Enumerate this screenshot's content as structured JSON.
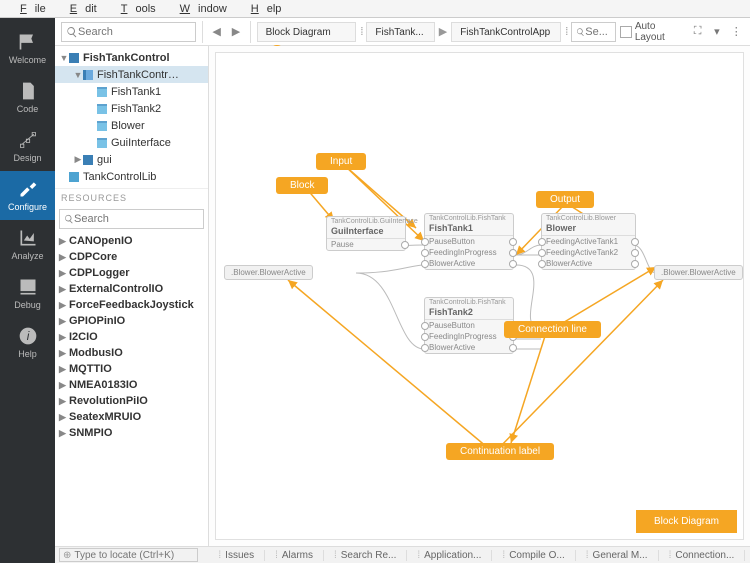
{
  "menu": {
    "file": "File",
    "edit": "Edit",
    "tools": "Tools",
    "window": "Window",
    "help": "Help"
  },
  "sidebar": {
    "items": [
      {
        "label": "Welcome"
      },
      {
        "label": "Code"
      },
      {
        "label": "Design"
      },
      {
        "label": "Configure"
      },
      {
        "label": "Analyze"
      },
      {
        "label": "Debug"
      },
      {
        "label": "Help"
      }
    ]
  },
  "toolbar": {
    "search_ph": "Search",
    "crumb_block": "Block Diagram",
    "crumb_app1": "FishTank...",
    "crumb_app2": "FishTankControlApp",
    "search2_ph": "Se...",
    "auto_layout": "Auto Layout"
  },
  "tree": [
    {
      "depth": 0,
      "tw": "▼",
      "icon": "ic-folder",
      "label": "FishTankControl",
      "bold": true
    },
    {
      "depth": 1,
      "tw": "▼",
      "icon": "ic-cmp",
      "label": "FishTankContr…",
      "selected": true
    },
    {
      "depth": 2,
      "tw": "",
      "icon": "ic-leaf",
      "label": "FishTank1"
    },
    {
      "depth": 2,
      "tw": "",
      "icon": "ic-leaf",
      "label": "FishTank2"
    },
    {
      "depth": 2,
      "tw": "",
      "icon": "ic-leaf",
      "label": "Blower"
    },
    {
      "depth": 2,
      "tw": "",
      "icon": "ic-leaf",
      "label": "GuiInterface"
    },
    {
      "depth": 1,
      "tw": "▶",
      "icon": "ic-folder",
      "label": "gui"
    },
    {
      "depth": 0,
      "tw": "",
      "icon": "ic-lib",
      "label": "TankControlLib"
    }
  ],
  "resources_header": "RESOURCES",
  "resources_search_ph": "Search",
  "resources": [
    "CANOpenIO",
    "CDPCore",
    "CDPLogger",
    "ExternalControlIO",
    "ForceFeedbackJoystick",
    "GPIOPinIO",
    "I2CIO",
    "ModbusIO",
    "MQTTIO",
    "NMEA0183IO",
    "RevolutionPiIO",
    "SeatexMRUIO",
    "SNMPIO"
  ],
  "diagram": {
    "blocks": {
      "gui": {
        "type": "TankControlLib.GuiInterface",
        "name": "GuiInterface",
        "rows": [
          "Pause"
        ]
      },
      "ft1": {
        "type": "TankControlLib.FishTank",
        "name": "FishTank1",
        "rows": [
          "PauseButton",
          "FeedingInProgress",
          "BlowerActive"
        ]
      },
      "ft2": {
        "type": "TankControlLib.FishTank",
        "name": "FishTank2",
        "rows": [
          "PauseButton",
          "FeedingInProgress",
          "BlowerActive"
        ]
      },
      "blower": {
        "type": "TankControlLib.Blower",
        "name": "Blower",
        "rows": [
          "FeedingActiveTank1",
          "FeedingActiveTank2",
          "BlowerActive"
        ]
      }
    },
    "cont_left": ".Blower.BlowerActive",
    "cont_right": ".Blower.BlowerActive",
    "callouts": {
      "input": "Input",
      "block": "Block",
      "output": "Output",
      "conn": "Connection line",
      "cont": "Continuation label"
    },
    "tab": "Block Diagram"
  },
  "bottom": {
    "locate_ph": "Type to locate (Ctrl+K)",
    "tabs": [
      "Issues",
      "Alarms",
      "Search Re...",
      "Application...",
      "Compile O...",
      "General M...",
      "Connection..."
    ]
  }
}
